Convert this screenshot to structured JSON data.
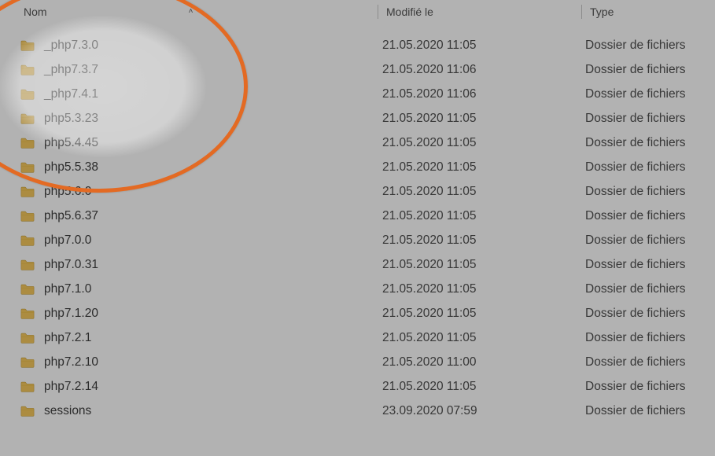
{
  "columns": {
    "name": "Nom",
    "modified": "Modifié le",
    "type": "Type"
  },
  "sort_indicator": "˄",
  "folder_type_label": "Dossier de fichiers",
  "rows": [
    {
      "name": "_php7.3.0",
      "modified": "21.05.2020 11:05",
      "type": "Dossier de fichiers"
    },
    {
      "name": "_php7.3.7",
      "modified": "21.05.2020 11:06",
      "type": "Dossier de fichiers"
    },
    {
      "name": "_php7.4.1",
      "modified": "21.05.2020 11:06",
      "type": "Dossier de fichiers"
    },
    {
      "name": "php5.3.23",
      "modified": "21.05.2020 11:05",
      "type": "Dossier de fichiers"
    },
    {
      "name": "php5.4.45",
      "modified": "21.05.2020 11:05",
      "type": "Dossier de fichiers"
    },
    {
      "name": "php5.5.38",
      "modified": "21.05.2020 11:05",
      "type": "Dossier de fichiers"
    },
    {
      "name": "php5.6.0",
      "modified": "21.05.2020 11:05",
      "type": "Dossier de fichiers"
    },
    {
      "name": "php5.6.37",
      "modified": "21.05.2020 11:05",
      "type": "Dossier de fichiers"
    },
    {
      "name": "php7.0.0",
      "modified": "21.05.2020 11:05",
      "type": "Dossier de fichiers"
    },
    {
      "name": "php7.0.31",
      "modified": "21.05.2020 11:05",
      "type": "Dossier de fichiers"
    },
    {
      "name": "php7.1.0",
      "modified": "21.05.2020 11:05",
      "type": "Dossier de fichiers"
    },
    {
      "name": "php7.1.20",
      "modified": "21.05.2020 11:05",
      "type": "Dossier de fichiers"
    },
    {
      "name": "php7.2.1",
      "modified": "21.05.2020 11:05",
      "type": "Dossier de fichiers"
    },
    {
      "name": "php7.2.10",
      "modified": "21.05.2020 11:00",
      "type": "Dossier de fichiers"
    },
    {
      "name": "php7.2.14",
      "modified": "21.05.2020 11:05",
      "type": "Dossier de fichiers"
    },
    {
      "name": "sessions",
      "modified": "23.09.2020 07:59",
      "type": "Dossier de fichiers"
    }
  ],
  "highlight": {
    "color": "#e36a23"
  }
}
